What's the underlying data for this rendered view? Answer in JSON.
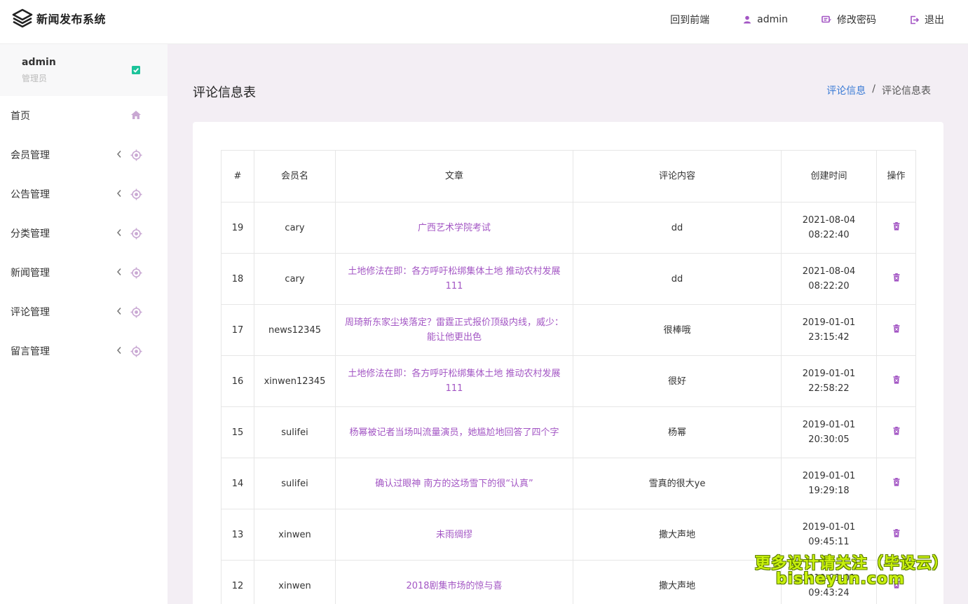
{
  "app": {
    "title": "新闻发布系统"
  },
  "topnav": {
    "frontend": "回到前端",
    "user": "admin",
    "change_password": "修改密码",
    "logout": "退出"
  },
  "sidebar": {
    "user": {
      "name": "admin",
      "role": "管理员"
    },
    "items": [
      {
        "label": "首页"
      },
      {
        "label": "会员管理"
      },
      {
        "label": "公告管理"
      },
      {
        "label": "分类管理"
      },
      {
        "label": "新闻管理"
      },
      {
        "label": "评论管理"
      },
      {
        "label": "留言管理"
      }
    ]
  },
  "page": {
    "title": "评论信息表",
    "breadcrumb": {
      "parent": "评论信息",
      "sep": "/",
      "current": "评论信息表"
    }
  },
  "table": {
    "headers": {
      "id": "#",
      "member": "会员名",
      "article": "文章",
      "content": "评论内容",
      "created": "创建时间",
      "action": "操作"
    },
    "rows": [
      {
        "id": "19",
        "member": "cary",
        "article": "广西艺术学院考试",
        "content": "dd",
        "created": "2021-08-04 08:22:40"
      },
      {
        "id": "18",
        "member": "cary",
        "article": "土地修法在即：各方呼吁松绑集体土地 推动农村发展111",
        "content": "dd",
        "created": "2021-08-04 08:22:20"
      },
      {
        "id": "17",
        "member": "news12345",
        "article": "周琦新东家尘埃落定？雷霆正式报价顶级内线，威少：能让他更出色",
        "content": "很棒哦",
        "created": "2019-01-01 23:15:42"
      },
      {
        "id": "16",
        "member": "xinwen12345",
        "article": "土地修法在即：各方呼吁松绑集体土地 推动农村发展111",
        "content": "很好",
        "created": "2019-01-01 22:58:22"
      },
      {
        "id": "15",
        "member": "sulifei",
        "article": "杨幂被记者当场叫流量演员，她尴尬地回答了四个字",
        "content": "杨幂",
        "created": "2019-01-01 20:30:05"
      },
      {
        "id": "14",
        "member": "sulifei",
        "article": "确认过眼神 南方的这场雪下的很“认真”",
        "content": "雪真的很大ye",
        "created": "2019-01-01 19:29:18"
      },
      {
        "id": "13",
        "member": "xinwen",
        "article": "未雨绸缪",
        "content": "撒大声地",
        "created": "2019-01-01 09:45:11"
      },
      {
        "id": "12",
        "member": "xinwen",
        "article": "2018剧集市场的惊与喜",
        "content": "撒大声地",
        "created": "2019-01-01 09:43:24"
      }
    ]
  },
  "watermark": {
    "line1": "更多设计请关注（毕设云）",
    "line2": "bisheyun.com"
  },
  "colors": {
    "accent": "#a356c4",
    "link": "#3a7bd5",
    "background": "#f3eef4",
    "icon": "#c9a8d3"
  }
}
